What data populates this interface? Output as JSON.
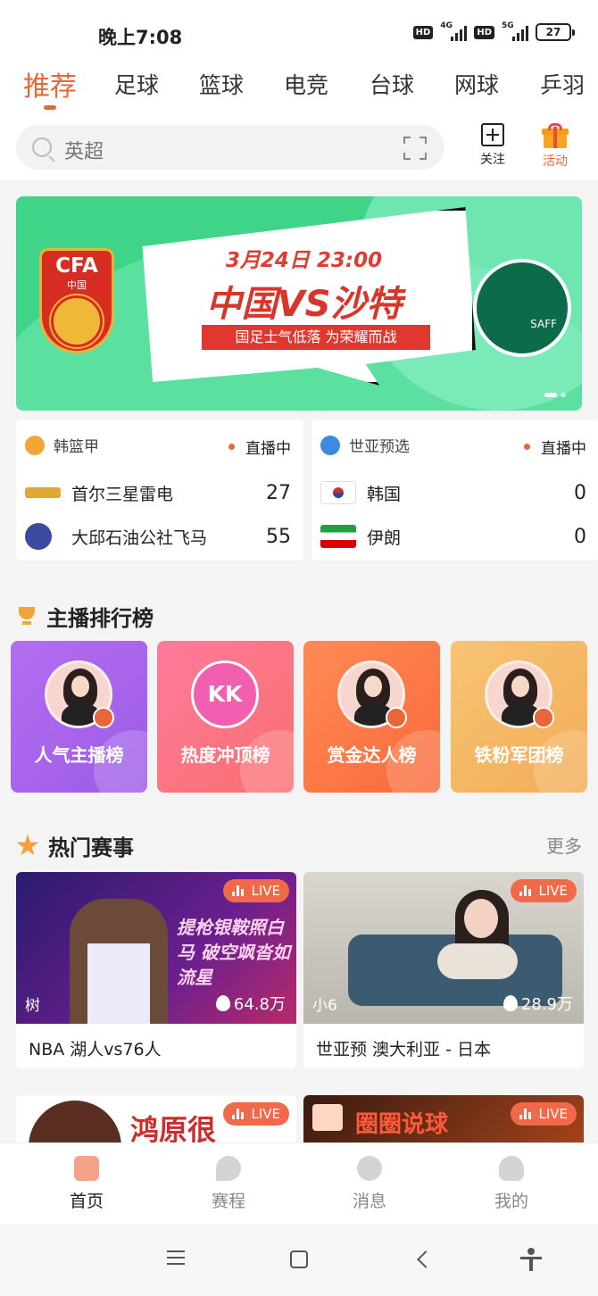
{
  "status_bar": {
    "time": "晚上7:08",
    "hd1": "HD",
    "net1": "4G",
    "hd2": "HD",
    "net2": "5G",
    "battery": "27"
  },
  "tabs": [
    "推荐",
    "足球",
    "篮球",
    "电竞",
    "台球",
    "网球",
    "乒羽"
  ],
  "search": {
    "placeholder": "英超"
  },
  "top_actions": {
    "follow": "关注",
    "activity": "活动"
  },
  "banner": {
    "date": "3月24日 23:00",
    "title": "中国VS沙特",
    "subtitle": "国足士气低落 为荣耀而战",
    "left_logo_text": "CFA",
    "left_logo_sub": "中国",
    "right_logo_text": "SAFF"
  },
  "matches": [
    {
      "league": "韩篮甲",
      "status": "直播中",
      "teams": [
        {
          "name": "首尔三星雷电",
          "score": "27"
        },
        {
          "name": "大邱石油公社飞马",
          "score": "55"
        }
      ]
    },
    {
      "league": "世亚预选",
      "status": "直播中",
      "teams": [
        {
          "name": "韩国",
          "score": "0"
        },
        {
          "name": "伊朗",
          "score": "0"
        }
      ]
    }
  ],
  "ranking": {
    "title": "主播排行榜",
    "cards": [
      {
        "label": "人气主播榜"
      },
      {
        "label": "热度冲顶榜",
        "logo": "KK"
      },
      {
        "label": "赏金达人榜"
      },
      {
        "label": "铁粉军团榜"
      }
    ]
  },
  "hot": {
    "title": "热门赛事",
    "more": "更多",
    "cards": [
      {
        "live": "LIVE",
        "thumb_text": "提枪银鞍照白马 破空飒沓如流星",
        "streamer": "树",
        "heat": "64.8万",
        "caption": "NBA 湖人vs76人"
      },
      {
        "live": "LIVE",
        "streamer": "小6",
        "heat": "28.9万",
        "caption": "世亚预 澳大利亚 - 日本"
      },
      {
        "live": "LIVE",
        "thumb_text": "鸿原很"
      },
      {
        "live": "LIVE",
        "thumb_text": "圈圈说球"
      }
    ]
  },
  "bottom_nav": [
    "首页",
    "赛程",
    "消息",
    "我的"
  ],
  "colors": {
    "accent": "#e8663a",
    "banner_green": "#40d488",
    "live_red": "#f06a4a"
  }
}
